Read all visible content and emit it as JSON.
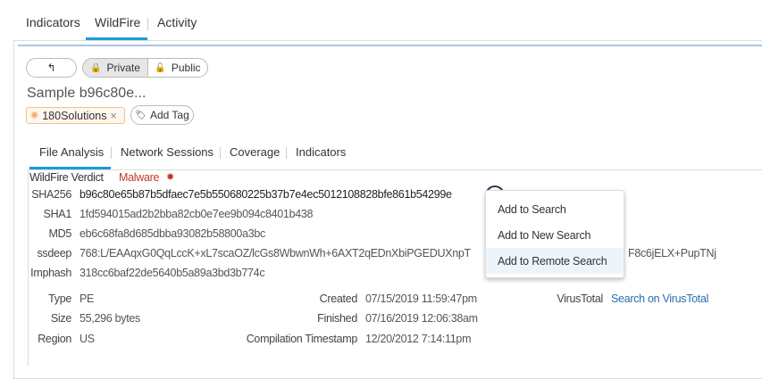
{
  "top_tabs": [
    {
      "label": "Indicators"
    },
    {
      "label": "WildFire",
      "active": true
    },
    {
      "label": "Activity"
    }
  ],
  "toolbar": {
    "back_icon": "back-arrow-icon",
    "private": "Private",
    "public": "Public"
  },
  "sample_title": "Sample b96c80e...",
  "tags": [
    {
      "label": "180Solutions",
      "close": "×"
    }
  ],
  "add_tag": "Add Tag",
  "sub_tabs": [
    {
      "label": "File Analysis",
      "active": true
    },
    {
      "label": "Network Sessions"
    },
    {
      "label": "Coverage"
    },
    {
      "label": "Indicators"
    }
  ],
  "verdict": {
    "label": "WildFire Verdict",
    "value": "Malware",
    "color": "#c0392b"
  },
  "hashes": [
    {
      "label": "SHA256",
      "value": "b96c80e65b87b5dfaec7e5b550680225b37b7e4ec5012108828bfe861b54299e"
    },
    {
      "label": "SHA1",
      "value": "1fd594015ad2b2bba82cb0e7ee9b094c8401b438"
    },
    {
      "label": "MD5",
      "value": "eb6c68fa8d685dbba93082b58800a3bc"
    },
    {
      "label": "ssdeep",
      "value": "768:L/EAAqxG0QqLccK+xL7scaOZ/lcGs8WbwnWh+6AXT2qEDnXbiPGEDUXnpT",
      "value_tail": "F8c6jELX+PupTNj"
    },
    {
      "label": "Imphash",
      "value": "318cc6baf22de5640b5a89a3bd3b774c"
    }
  ],
  "details": {
    "type": {
      "label": "Type",
      "value": "PE"
    },
    "size": {
      "label": "Size",
      "value": "55,296 bytes"
    },
    "region": {
      "label": "Region",
      "value": "US"
    },
    "created": {
      "label": "Created",
      "value": "07/15/2019 11:59:47pm"
    },
    "finished": {
      "label": "Finished",
      "value": "07/16/2019 12:06:38am"
    },
    "compilation": {
      "label": "Compilation Timestamp",
      "value": "12/20/2012 7:14:11pm"
    },
    "virustotal": {
      "label": "VirusTotal",
      "value": "Search on VirusTotal"
    }
  },
  "context_menu": {
    "items": [
      "Add to Search",
      "Add to New Search",
      "Add to Remote Search"
    ],
    "highlighted": 2
  },
  "colors": {
    "accent": "#1a9bdb",
    "link": "#2a6fb0"
  }
}
